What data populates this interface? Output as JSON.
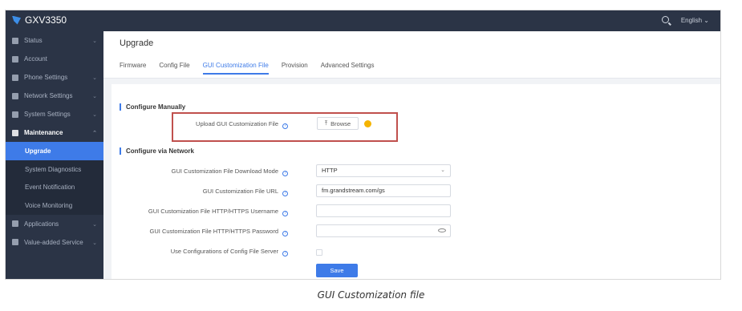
{
  "app": {
    "title": "GXV3350",
    "language": "English"
  },
  "sidebar": {
    "items": [
      {
        "label": "Status",
        "icon": "list-icon"
      },
      {
        "label": "Account",
        "icon": "user-icon"
      },
      {
        "label": "Phone Settings",
        "icon": "phone-icon"
      },
      {
        "label": "Network Settings",
        "icon": "network-icon"
      },
      {
        "label": "System Settings",
        "icon": "system-icon"
      },
      {
        "label": "Maintenance",
        "icon": "tools-icon"
      },
      {
        "label": "Upgrade"
      },
      {
        "label": "System Diagnostics"
      },
      {
        "label": "Event Notification"
      },
      {
        "label": "Voice Monitoring"
      },
      {
        "label": "Applications",
        "icon": "apps-icon"
      },
      {
        "label": "Value-added Service",
        "icon": "grid-icon"
      }
    ]
  },
  "page": {
    "title": "Upgrade",
    "tabs": [
      "Firmware",
      "Config File",
      "GUI Customization File",
      "Provision",
      "Advanced Settings"
    ],
    "active_tab": "GUI Customization File"
  },
  "form": {
    "section_manual": "Configure Manually",
    "upload_label": "Upload GUI Customization File",
    "browse_label": "Browse",
    "section_network": "Configure via Network",
    "download_mode_label": "GUI Customization File Download Mode",
    "download_mode_value": "HTTP",
    "url_label": "GUI Customization File URL",
    "url_value": "fm.grandstream.com/gs",
    "username_label": "GUI Customization File HTTP/HTTPS Username",
    "username_value": "",
    "password_label": "GUI Customization File HTTP/HTTPS Password",
    "password_value": "",
    "use_config_label": "Use Configurations of Config File Server",
    "save_label": "Save"
  },
  "caption": "GUI Customization file",
  "colors": {
    "accent": "#3e7be8",
    "sidebar": "#2b3446",
    "highlight": "#c0504d"
  }
}
